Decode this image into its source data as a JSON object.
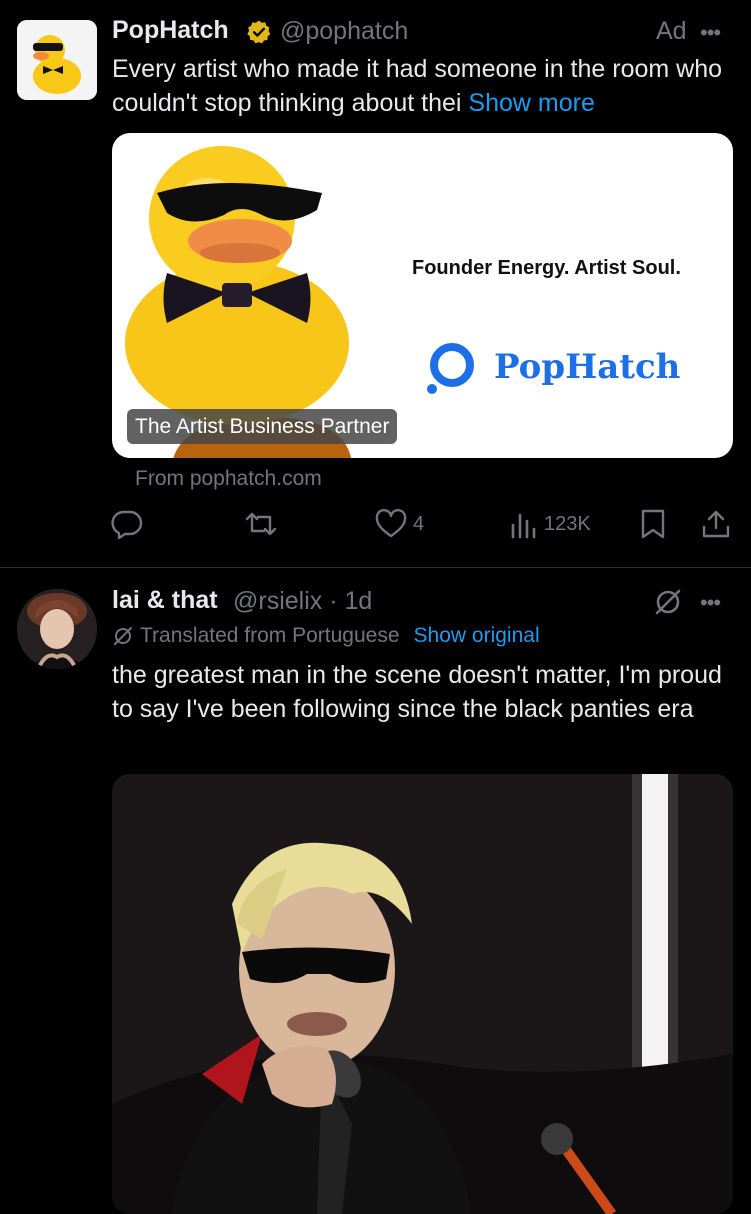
{
  "ad_post": {
    "author_name": "PopHatch",
    "author_handle": "@pophatch",
    "ad_label": "Ad",
    "more_label": "•••",
    "text": "Every artist who made it had someone in the room who couldn't stop thinking about thei",
    "show_more": "Show more",
    "card": {
      "tagline": "Founder Energy. Artist Soul.",
      "brand": "PopHatch",
      "label": "The Artist Business Partner"
    },
    "source": "From pophatch.com",
    "likes": "4",
    "views": "123K"
  },
  "post": {
    "author_name": "lai & that",
    "author_handle": "@rsielix",
    "time": "· 1d",
    "more_label": "•••",
    "translated_label": "Translated from Portuguese",
    "show_original": "Show original",
    "text": "the greatest man in the scene doesn't matter, I'm proud to say I've been following since the black panties era"
  },
  "colors": {
    "background": "#000000",
    "text": "#e7e9ea",
    "secondary": "#71767b",
    "accent": "#1d9bf0",
    "verified": "#e2b719"
  }
}
